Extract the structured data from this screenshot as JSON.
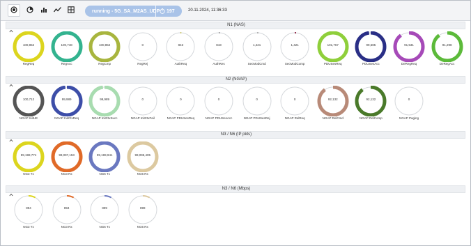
{
  "toolbar": {
    "buttons": [
      {
        "name": "radio-icon",
        "active": true
      },
      {
        "name": "gauge-icon",
        "active": false
      },
      {
        "name": "bar-chart-icon",
        "active": false
      },
      {
        "name": "line-chart-icon",
        "active": false
      },
      {
        "name": "grid-icon",
        "active": false
      }
    ],
    "status_text": "running - 5G_SA_M2AS_UDP",
    "timer_value": "197",
    "datetime": "20.11.2024, 11:36:33"
  },
  "sections": [
    {
      "title": "N1 (NAS)",
      "gauges": [
        {
          "label": "RegReq",
          "value": "100,852",
          "fill": 1.0,
          "color": "#dcd51e"
        },
        {
          "label": "RegAcc",
          "value": "100,748",
          "fill": 1.0,
          "color": "#33b38f"
        },
        {
          "label": "RegCmp",
          "value": "100,852",
          "fill": 1.0,
          "color": "#a8b53e"
        },
        {
          "label": "RegRej",
          "value": "0",
          "fill": 0.0,
          "color": "#999999"
        },
        {
          "label": "AuthReq",
          "value": "843",
          "fill": 0.01,
          "color": "#c8c24a"
        },
        {
          "label": "AuthRes",
          "value": "843",
          "fill": 0.01,
          "color": "#888888"
        },
        {
          "label": "SecModCmd",
          "value": "1,421",
          "fill": 0.015,
          "color": "#b0b0b0"
        },
        {
          "label": "SecModComp",
          "value": "1,421",
          "fill": 0.015,
          "color": "#8a1a3a"
        },
        {
          "label": "PDUSesReq",
          "value": "101,767",
          "fill": 1.0,
          "color": "#8fcf3b"
        },
        {
          "label": "PDUSesAcc",
          "value": "99,585",
          "fill": 0.98,
          "color": "#2a2f86"
        },
        {
          "label": "DeRegReq",
          "value": "91,531",
          "fill": 0.9,
          "color": "#a64ab8"
        },
        {
          "label": "DeRegAcc",
          "value": "91,298",
          "fill": 0.9,
          "color": "#5cba3a"
        }
      ]
    },
    {
      "title": "N2 (NGAP)",
      "gauges": [
        {
          "label": "NGAP InitUE",
          "value": "100,712",
          "fill": 1.0,
          "color": "#555555"
        },
        {
          "label": "NGAP InitCtxReq",
          "value": "99,989",
          "fill": 0.98,
          "color": "#3d4ea8"
        },
        {
          "label": "NGAP InitCtxSucc",
          "value": "99,989",
          "fill": 0.98,
          "color": "#a8dcb0"
        },
        {
          "label": "NGAP InitCtxFail",
          "value": "0",
          "fill": 0.0,
          "color": "#999999"
        },
        {
          "label": "NGAP PDUSesReq",
          "value": "0",
          "fill": 0.0,
          "color": "#999999"
        },
        {
          "label": "NGAP PDUSesAcc",
          "value": "0",
          "fill": 0.0,
          "color": "#999999"
        },
        {
          "label": "NGAP PDUSesRej",
          "value": "0",
          "fill": 0.0,
          "color": "#999999"
        },
        {
          "label": "NGAP RelReq",
          "value": "0",
          "fill": 0.0,
          "color": "#999999"
        },
        {
          "label": "NGAP RelCmd",
          "value": "92,132",
          "fill": 0.9,
          "color": "#b88a78"
        },
        {
          "label": "NGAP RelComp",
          "value": "92,132",
          "fill": 0.9,
          "color": "#4a7a2a"
        },
        {
          "label": "NGAP Paging",
          "value": "0",
          "fill": 0.0,
          "color": "#999999"
        }
      ]
    },
    {
      "title": "N3 / N6 (IP pkts)",
      "gauges": [
        {
          "label": "NG3 Tx",
          "value": "99,198,774",
          "fill": 1.0,
          "color": "#dcd51e"
        },
        {
          "label": "NG3 Rx",
          "value": "99,097,153",
          "fill": 1.0,
          "color": "#e06a28"
        },
        {
          "label": "NG6 Tx",
          "value": "99,199,941",
          "fill": 1.0,
          "color": "#6a78c0"
        },
        {
          "label": "NG6 Rx",
          "value": "99,095,405",
          "fill": 1.0,
          "color": "#dcc9a0"
        }
      ]
    },
    {
      "title": "N3 / N6 (Mbps)",
      "gauges": [
        {
          "label": "NG3 Tx",
          "value": "894",
          "fill": 0.08,
          "color": "#dcd51e"
        },
        {
          "label": "NG3 Rx",
          "value": "894",
          "fill": 0.08,
          "color": "#e06a28"
        },
        {
          "label": "NG6 Tx",
          "value": "899",
          "fill": 0.08,
          "color": "#6a78c0"
        },
        {
          "label": "NG6 Rx",
          "value": "899",
          "fill": 0.08,
          "color": "#dcc9a0"
        }
      ]
    }
  ]
}
